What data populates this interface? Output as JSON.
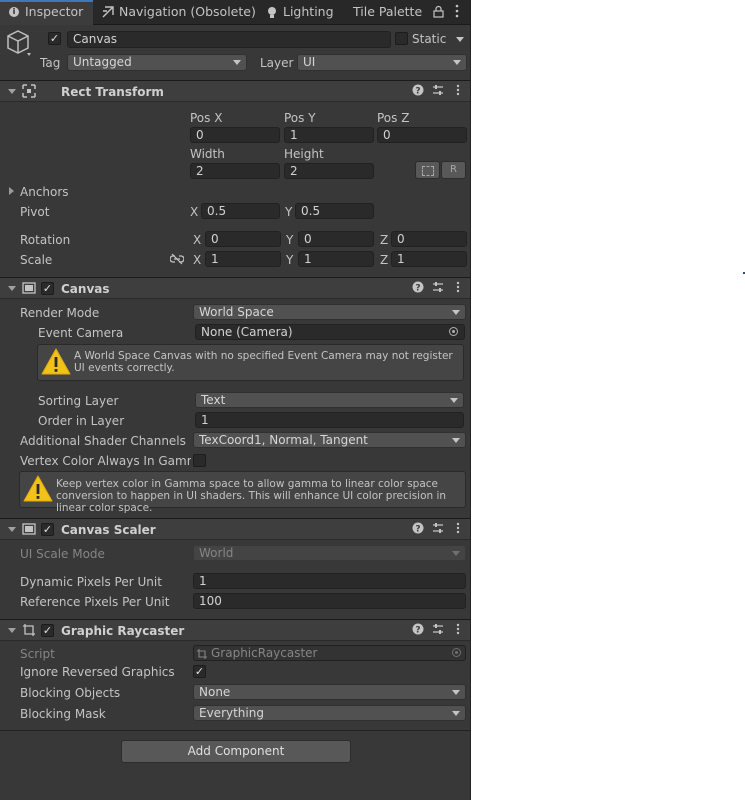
{
  "tabs": [
    {
      "label": "Inspector",
      "active": true
    },
    {
      "label": "Navigation (Obsolete)",
      "active": false
    },
    {
      "label": "Lighting",
      "active": false
    },
    {
      "label": "Tile Palette",
      "active": false
    }
  ],
  "object": {
    "name": "Canvas",
    "active_checked": true,
    "static_label": "Static",
    "tag_label": "Tag",
    "tag_value": "Untagged",
    "layer_label": "Layer",
    "layer_value": "UI"
  },
  "rect_transform": {
    "title": "Rect Transform",
    "pos_x_label": "Pos X",
    "pos_y_label": "Pos Y",
    "pos_z_label": "Pos Z",
    "pos_x": "0",
    "pos_y": "1",
    "pos_z": "0",
    "width_label": "Width",
    "height_label": "Height",
    "width": "2",
    "height": "2",
    "raw_button": "R",
    "anchors_label": "Anchors",
    "pivot_label": "Pivot",
    "pivot_x": "0.5",
    "pivot_y": "0.5",
    "rotation_label": "Rotation",
    "rot_x": "0",
    "rot_y": "0",
    "rot_z": "0",
    "scale_label": "Scale",
    "scale_x": "1",
    "scale_y": "1",
    "scale_z": "1",
    "axis_x": "X",
    "axis_y": "Y",
    "axis_z": "Z"
  },
  "canvas": {
    "title": "Canvas",
    "enabled": true,
    "render_mode_label": "Render Mode",
    "render_mode_value": "World Space",
    "event_camera_label": "Event Camera",
    "event_camera_value": "None (Camera)",
    "warning_1": "A World Space Canvas with no specified Event Camera may not register UI events correctly.",
    "sorting_layer_label": "Sorting Layer",
    "sorting_layer_value": "Text",
    "order_in_layer_label": "Order in Layer",
    "order_in_layer_value": "1",
    "shader_channels_label": "Additional Shader Channels",
    "shader_channels_value": "TexCoord1, Normal, Tangent",
    "vertex_color_label": "Vertex Color Always In Gamma",
    "vertex_color_checked": false,
    "warning_2": "Keep vertex color in Gamma space to allow gamma to linear color space conversion to happen in UI shaders. This will enhance UI color precision in linear color space."
  },
  "canvas_scaler": {
    "title": "Canvas Scaler",
    "enabled": true,
    "ui_scale_mode_label": "UI Scale Mode",
    "ui_scale_mode_value": "World",
    "dynamic_pixels_label": "Dynamic Pixels Per Unit",
    "dynamic_pixels_value": "1",
    "reference_pixels_label": "Reference Pixels Per Unit",
    "reference_pixels_value": "100"
  },
  "graphic_raycaster": {
    "title": "Graphic Raycaster",
    "enabled": true,
    "script_label": "Script",
    "script_value": "GraphicRaycaster",
    "ignore_reversed_label": "Ignore Reversed Graphics",
    "ignore_reversed_checked": true,
    "blocking_objects_label": "Blocking Objects",
    "blocking_objects_value": "None",
    "blocking_mask_label": "Blocking Mask",
    "blocking_mask_value": "Everything"
  },
  "add_component_label": "Add Component",
  "colors": {
    "panel_bg": "#383838",
    "header_bg": "#3e3e3e",
    "field_bg": "#2a2a2a",
    "dropdown_bg": "#515151",
    "warning_yellow": "#f2c21b",
    "text": "#c4c4c4"
  }
}
